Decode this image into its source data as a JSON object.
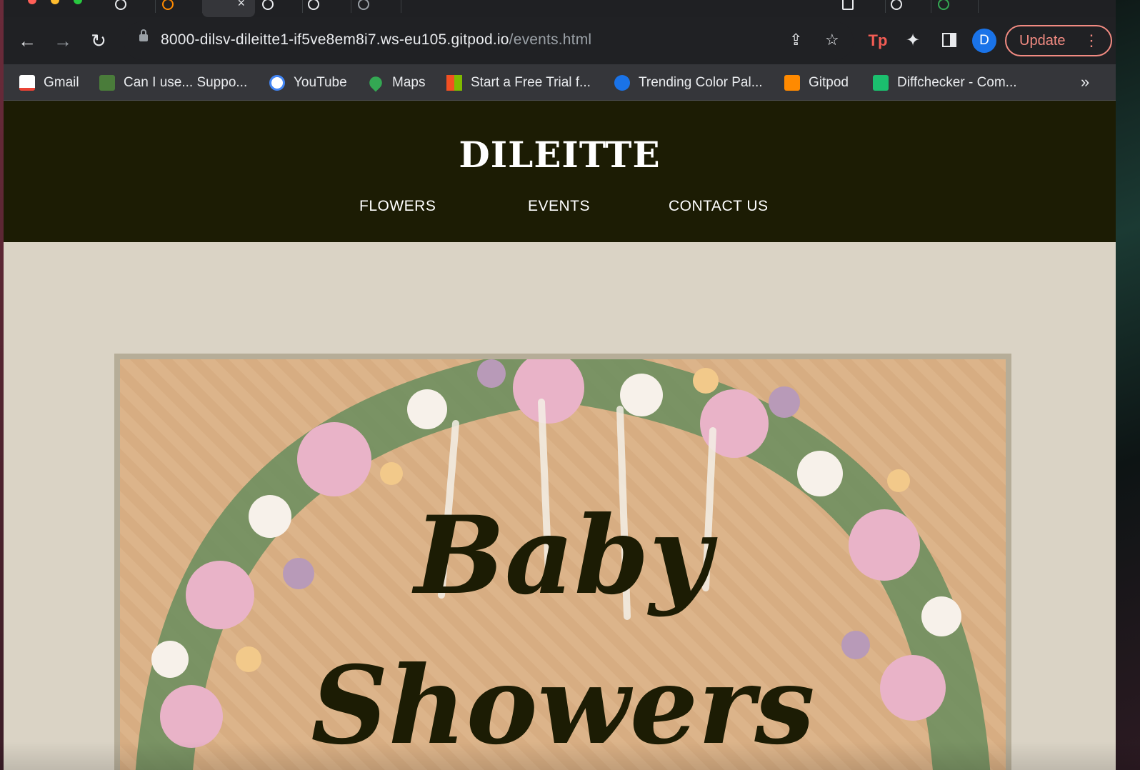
{
  "browser": {
    "address_bar": {
      "url_host": "8000-dilsv-dileitte1-if5ve8em8i7.ws-eu105.gitpod.io",
      "url_path": "/events.html"
    },
    "profile_initial": "D",
    "update_label": "Update",
    "bookmarks": [
      {
        "label": "Gmail",
        "icon": "gmail-icon",
        "color": "#ea4335"
      },
      {
        "label": "Can I use... Suppo...",
        "icon": "caniuse-icon",
        "color": "#4a7c3a"
      },
      {
        "label": "YouTube",
        "icon": "google-icon",
        "color": "#ffffff"
      },
      {
        "label": "Maps",
        "icon": "maps-icon",
        "color": "#34a853"
      },
      {
        "label": "Start a Free Trial f...",
        "icon": "microsoft-icon",
        "color": "#f25022"
      },
      {
        "label": "Trending Color Pal...",
        "icon": "coolors-icon",
        "color": "#1a73e8"
      },
      {
        "label": "Gitpod",
        "icon": "gitpod-icon",
        "color": "#ff8a00"
      },
      {
        "label": "Diffchecker - Com...",
        "icon": "diffchecker-icon",
        "color": "#1bbf6e"
      }
    ],
    "bookmarks_overflow": "»"
  },
  "site": {
    "logo": "DILEITTE",
    "nav": [
      "FLOWERS",
      "EVENTS",
      "CONTACT US"
    ],
    "hero": {
      "line1": "Baby",
      "line2": "Showers"
    },
    "colors": {
      "header_bg": "#1c1c04",
      "page_bg": "#dad3c5",
      "frame": "#b6ad98"
    }
  }
}
